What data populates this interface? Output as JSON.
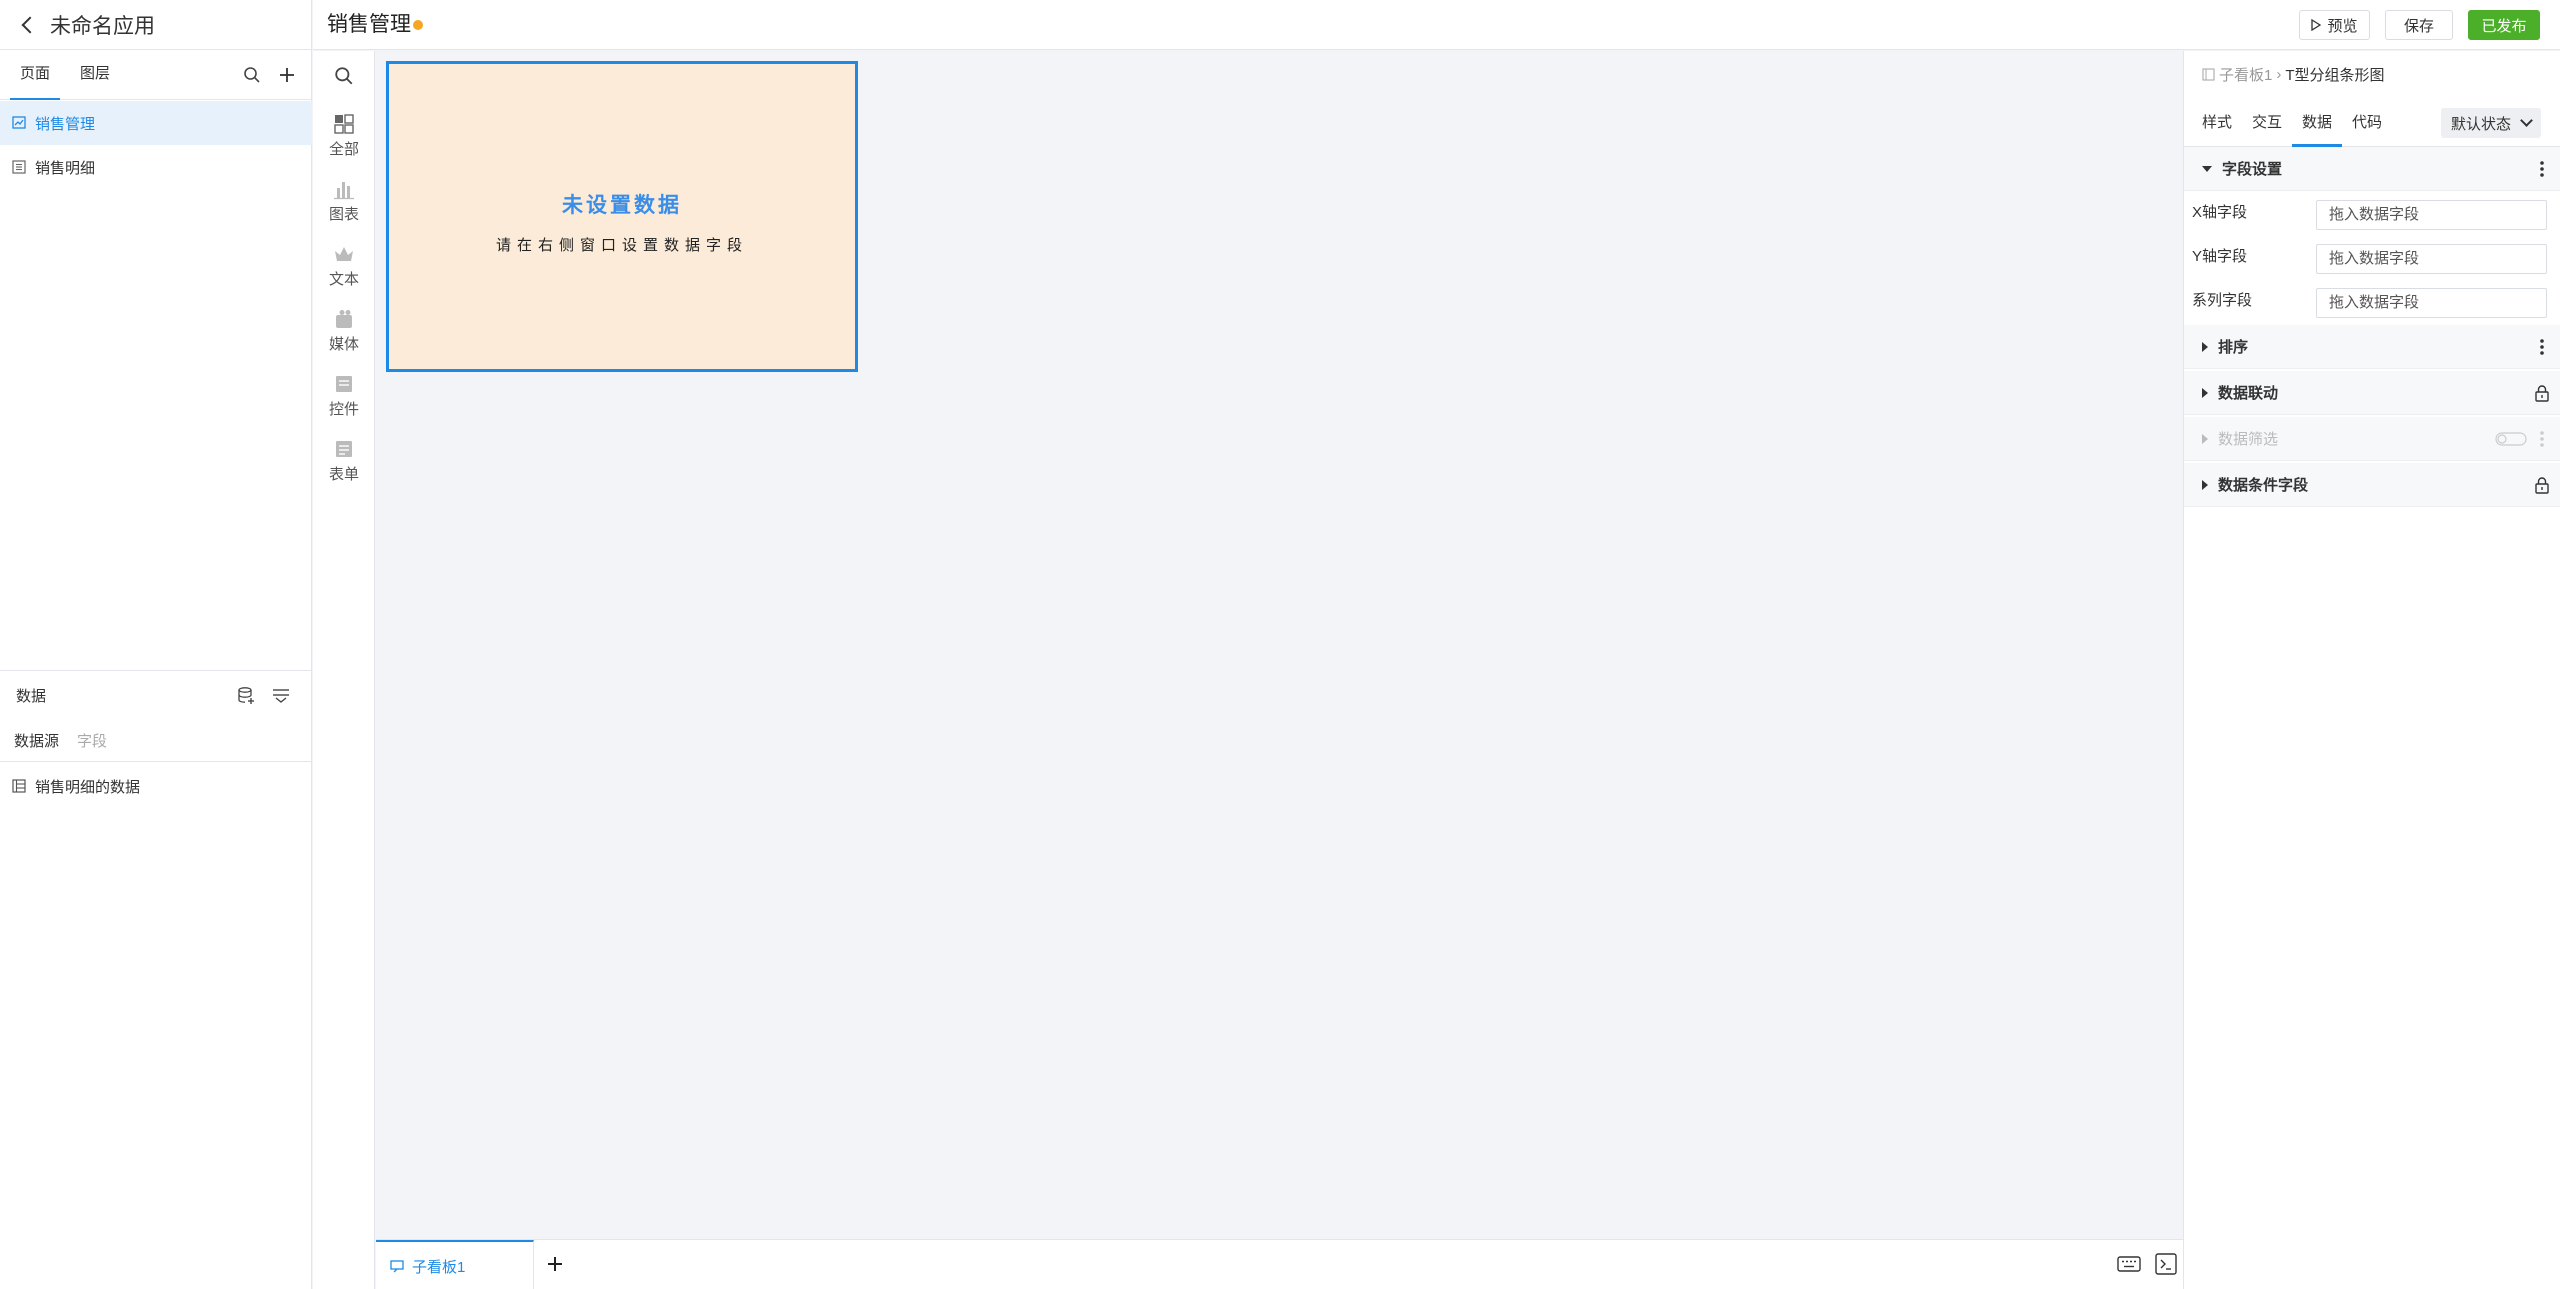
{
  "app": {
    "title": "未命名应用"
  },
  "left_panel": {
    "tabs": [
      "页面",
      "图层"
    ],
    "pages": [
      {
        "label": "销售管理",
        "selected": true
      },
      {
        "label": "销售明细",
        "selected": false
      }
    ],
    "data_section": {
      "title": "数据",
      "tabs": [
        "数据源",
        "字段"
      ],
      "sources": [
        "销售明细的数据"
      ]
    }
  },
  "topbar": {
    "doc_title": "销售管理",
    "preview_label": "预览",
    "save_label": "保存",
    "published_label": "已发布",
    "published_color": "#4caf29",
    "dirty_color": "#f5a623"
  },
  "component_bar": {
    "items": [
      {
        "label": "全部",
        "icon": "grid-icon"
      },
      {
        "label": "图表",
        "icon": "bar-chart-icon"
      },
      {
        "label": "文本",
        "icon": "text-crown-icon"
      },
      {
        "label": "媒体",
        "icon": "media-icon"
      },
      {
        "label": "控件",
        "icon": "control-icon"
      },
      {
        "label": "表单",
        "icon": "form-icon"
      }
    ]
  },
  "canvas": {
    "widget": {
      "title": "未设置数据",
      "subtitle": "请在右侧窗口设置数据字段",
      "background": "#fbebd8",
      "accent": "#1f8ae6"
    }
  },
  "bottom_bar": {
    "tabs": [
      "子看板1"
    ]
  },
  "right_panel": {
    "breadcrumb": {
      "parent": "子看板1",
      "current": "T型分组条形图"
    },
    "tabs": [
      "样式",
      "交互",
      "数据",
      "代码"
    ],
    "active_tab": "数据",
    "state_select": "默认状态",
    "sections": {
      "fields": "字段设置",
      "sort": "排序",
      "linkage": "数据联动",
      "filter": "数据筛选",
      "condition": "数据条件字段"
    },
    "fields": [
      {
        "label": "X轴字段",
        "placeholder": "拖入数据字段"
      },
      {
        "label": "Y轴字段",
        "placeholder": "拖入数据字段"
      },
      {
        "label": "系列字段",
        "placeholder": "拖入数据字段"
      }
    ]
  }
}
